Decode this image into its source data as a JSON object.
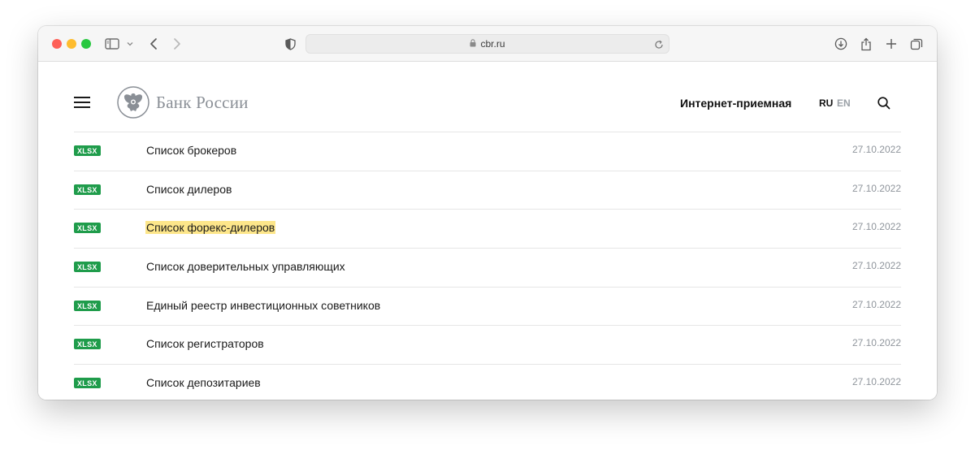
{
  "browser": {
    "url": "cbr.ru"
  },
  "site": {
    "logo_text": "Банк России",
    "reception_link": "Интернет-приемная",
    "lang_ru": "RU",
    "lang_en": "EN"
  },
  "documents": [
    {
      "badge": "XLSX",
      "title": "Список брокеров",
      "date": "27.10.2022",
      "highlighted": false
    },
    {
      "badge": "XLSX",
      "title": "Список дилеров",
      "date": "27.10.2022",
      "highlighted": false
    },
    {
      "badge": "XLSX",
      "title": "Список форекс-дилеров",
      "date": "27.10.2022",
      "highlighted": true
    },
    {
      "badge": "XLSX",
      "title": "Список доверительных управляющих",
      "date": "27.10.2022",
      "highlighted": false
    },
    {
      "badge": "XLSX",
      "title": "Единый реестр инвестиционных советников",
      "date": "27.10.2022",
      "highlighted": false
    },
    {
      "badge": "XLSX",
      "title": "Список регистраторов",
      "date": "27.10.2022",
      "highlighted": false
    },
    {
      "badge": "XLSX",
      "title": "Список депозитариев",
      "date": "27.10.2022",
      "highlighted": false
    }
  ],
  "colors": {
    "badge_green": "#1f9c4b",
    "highlight": "#fde68a",
    "date_gray": "#8f959c"
  }
}
